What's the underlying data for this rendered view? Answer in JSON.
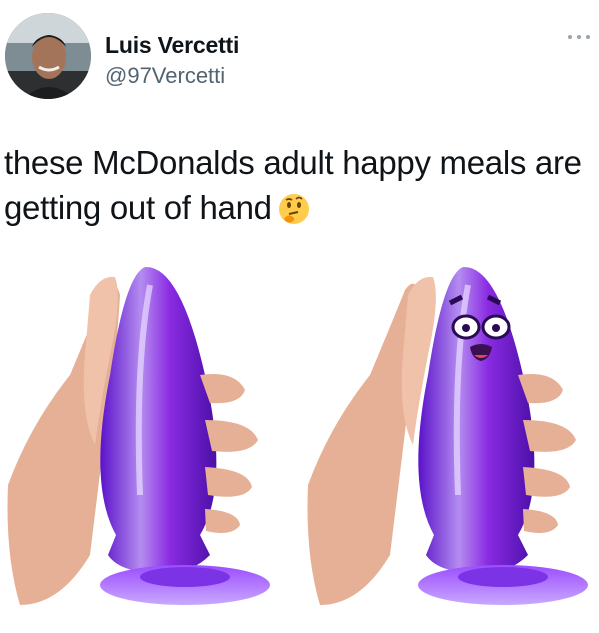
{
  "tweet": {
    "author_name": "Luis Vercetti",
    "handle": "@97Vercetti",
    "text": "these McDonalds adult happy meals are getting out of hand",
    "emoji_icon": "thinking-face-emoji"
  },
  "icons": {
    "more": "more-options-icon"
  },
  "colors": {
    "text": "#0f1419",
    "handle": "#536471",
    "purple": "#8a2be2",
    "skin": "#e8b59a"
  }
}
